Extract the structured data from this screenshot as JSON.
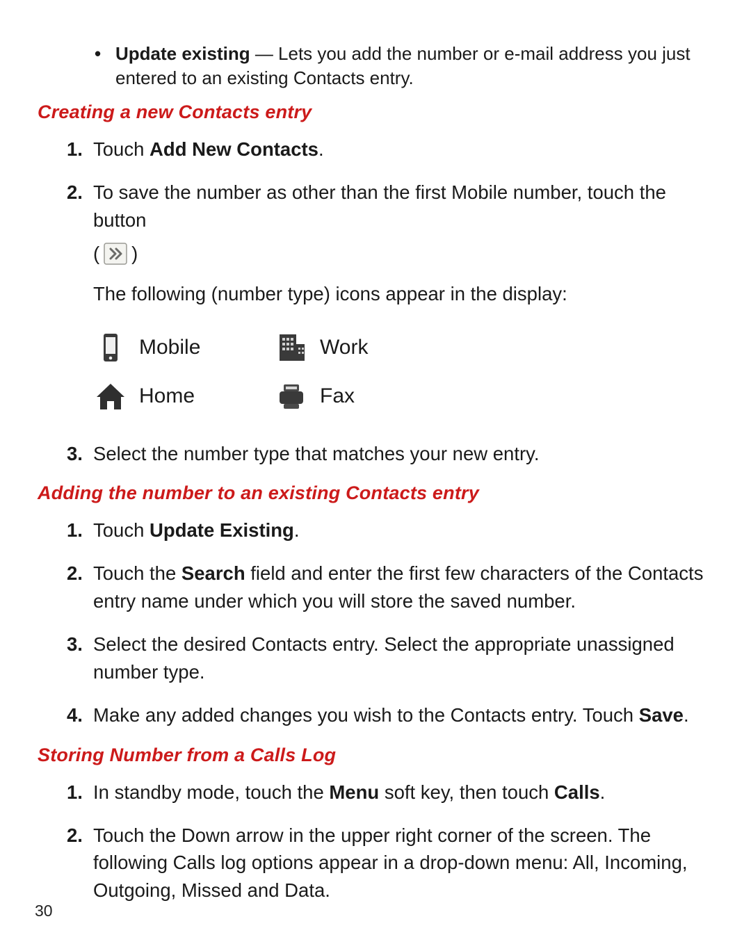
{
  "bullet": {
    "lead": "Update existing",
    "rest": " — Lets you add the number or e-mail address you just entered to an existing Contacts entry."
  },
  "section1": {
    "title": "Creating a new Contacts entry",
    "step1_pre": "Touch ",
    "step1_b": "Add New Contacts",
    "step1_post": ".",
    "step2": "To save the number as other than the first Mobile number, touch the button",
    "step2_line2": "The following (number type) icons appear in the display:",
    "step3": "Select the number type that matches your new entry."
  },
  "icons": {
    "mobile": "Mobile",
    "work": "Work",
    "home": "Home",
    "fax": "Fax"
  },
  "section2": {
    "title": "Adding the number to an existing Contacts entry",
    "step1_pre": "Touch ",
    "step1_b": "Update Existing",
    "step1_post": ".",
    "step2_pre": "Touch the ",
    "step2_b": "Search",
    "step2_post": " field and enter the first few characters of the Contacts entry name under which you will store the saved number.",
    "step3": "Select the desired Contacts entry. Select the appropriate unassigned number type.",
    "step4_pre": "Make any added changes you wish to the Contacts entry. Touch ",
    "step4_b": "Save",
    "step4_post": "."
  },
  "section3": {
    "title": "Storing Number from a Calls Log",
    "step1_pre": "In standby mode, touch the ",
    "step1_b1": "Menu",
    "step1_mid": " soft key, then touch ",
    "step1_b2": "Calls",
    "step1_post": ".",
    "step2": "Touch the Down arrow in the upper right corner of the screen. The following Calls log options appear in a drop-down menu: All, Incoming, Outgoing, Missed and Data."
  },
  "page": "30"
}
